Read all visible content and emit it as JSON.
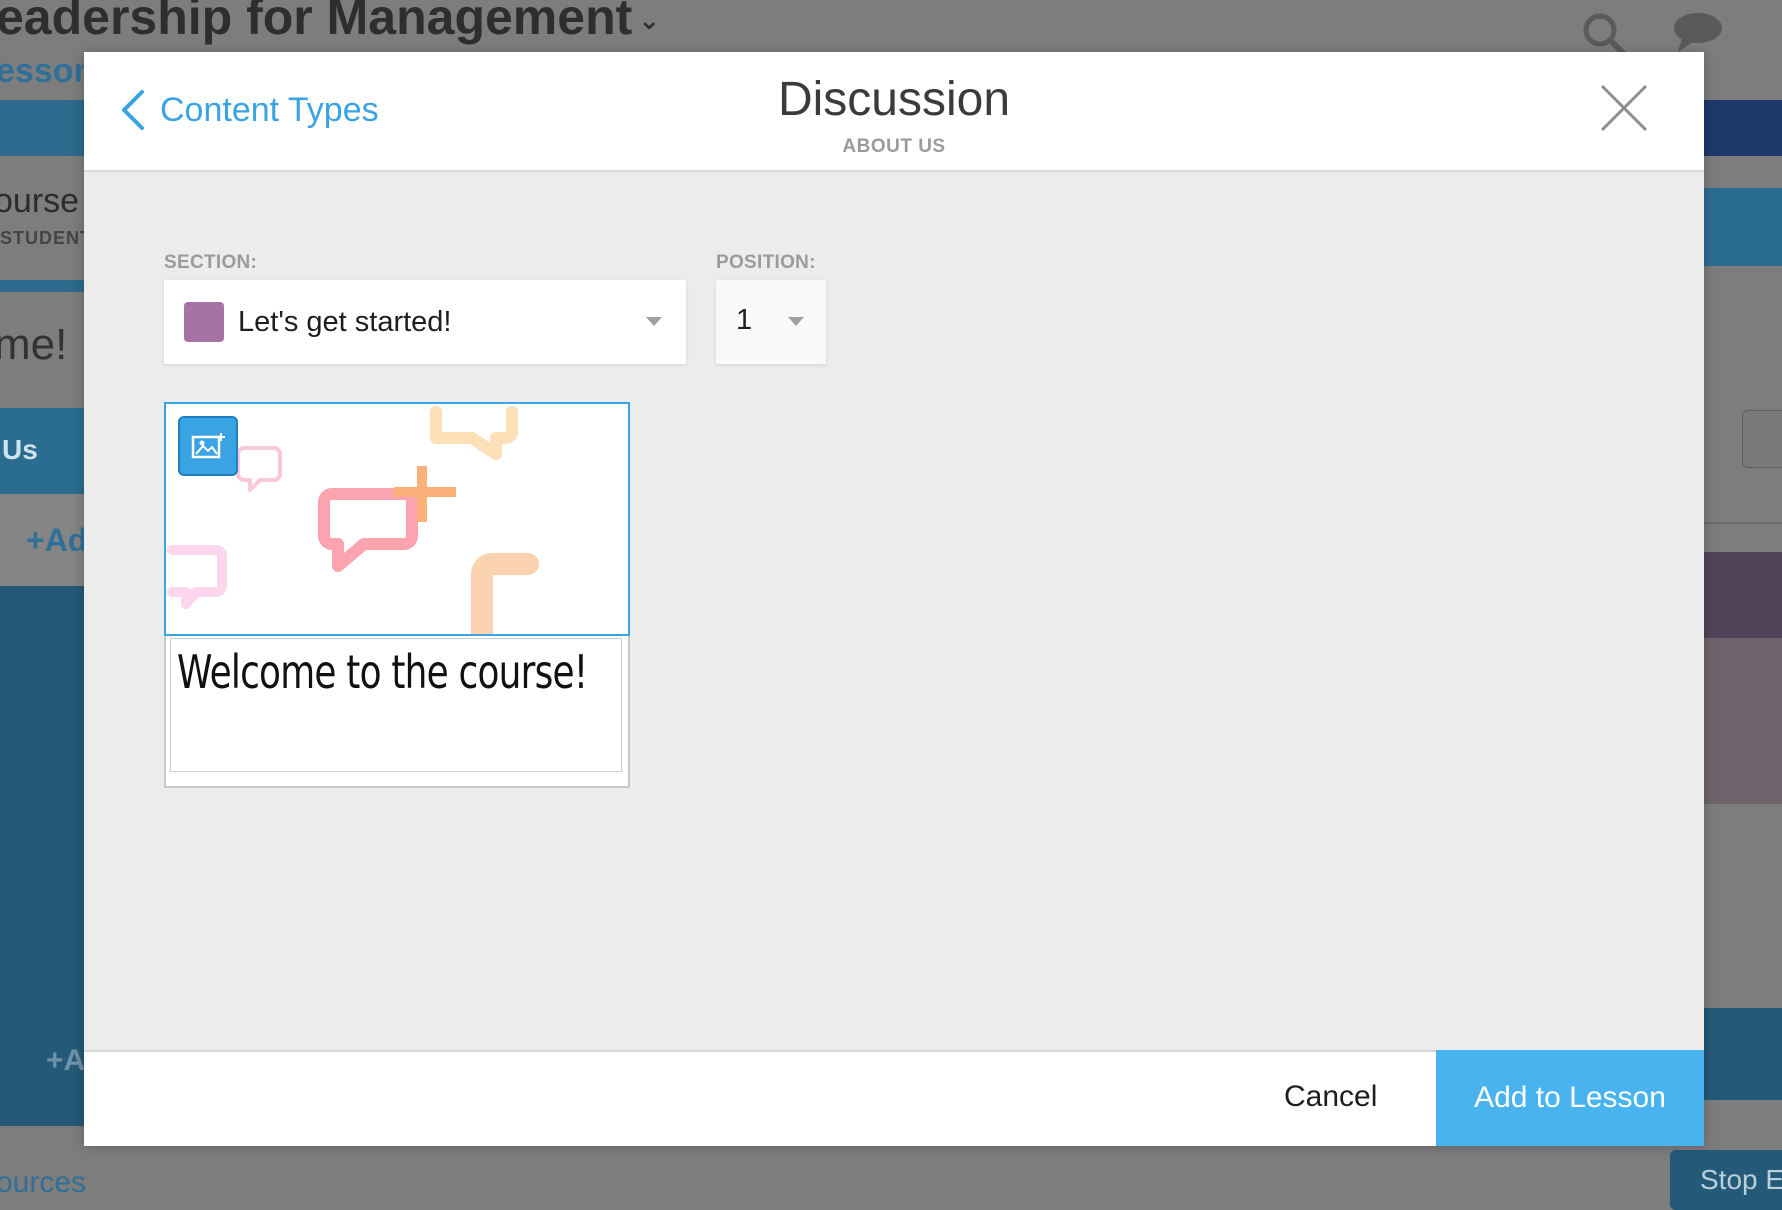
{
  "background": {
    "course_title": "eadership for Management",
    "lessons_link": "essons",
    "course_label": "ourse",
    "students_label": "STUDENT",
    "welcome_partial": "me!",
    "about_us_partial": "Us",
    "add_partial_1": "+Ad",
    "add_partial_2": "+A",
    "resources_partial": "ources",
    "stop_partial": "Stop E"
  },
  "modal": {
    "back_label": "Content Types",
    "title": "Discussion",
    "subtitle": "ABOUT US",
    "section_label": "SECTION:",
    "section_value": "Let's get started!",
    "section_color": "#a773a5",
    "position_label": "POSITION:",
    "position_value": "1",
    "card_title": "Welcome to the course!",
    "cancel_label": "Cancel",
    "primary_label": "Add to Lesson"
  },
  "icons": {
    "back": "chevron-left-icon",
    "close": "close-icon",
    "image": "add-image-icon",
    "search": "search-icon",
    "chat": "chat-icon"
  },
  "colors": {
    "accent": "#3aa3e3",
    "primary_button": "#48b3ef"
  }
}
